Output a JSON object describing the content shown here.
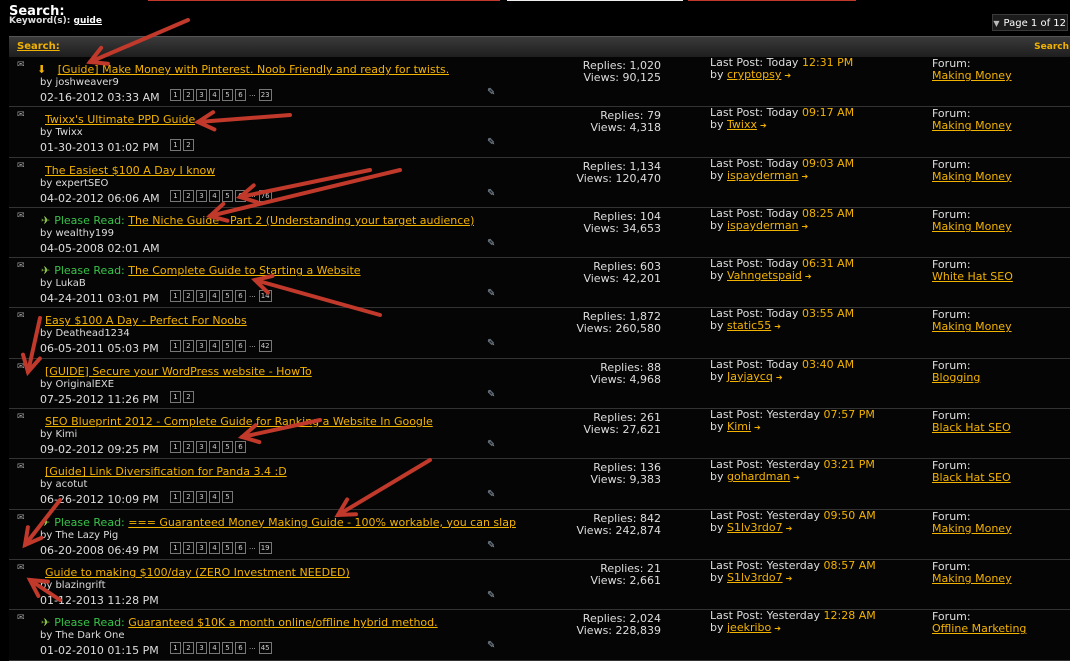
{
  "header": {
    "title": "Search:",
    "keywords_label": "Keyword(s):",
    "keyword": "guide",
    "page_indicator": "Page 1 of 12"
  },
  "table": {
    "title": "Search:",
    "right_label": "Search"
  },
  "colors": {
    "accent": "#f2b200",
    "prefix": "#39c34a",
    "arrow": "#c0392b"
  },
  "threads": [
    {
      "prefix": "",
      "down": "⬇",
      "title": "[Guide] Make Money with Pinterest. Noob Friendly and ready for twists.",
      "author": "joshweaver9",
      "date": "02-16-2012 03:33 AM",
      "pages": [
        "1",
        "2",
        "3",
        "4",
        "5",
        "6",
        "...",
        "23"
      ],
      "replies": "Replies: 1,020",
      "views": "Views: 90,125",
      "last_label": "Last Post: Today",
      "last_time": "12:31 PM",
      "last_user": "cryptopsy",
      "forum_label": "Forum:",
      "forum": "Making Money"
    },
    {
      "prefix": "",
      "down": "",
      "title": "Twixx's Ultimate PPD Guide",
      "author": "Twixx",
      "date": "01-30-2013 01:02 PM",
      "pages": [
        "1",
        "2"
      ],
      "replies": "Replies: 79",
      "views": "Views: 4,318",
      "last_label": "Last Post: Today",
      "last_time": "09:17 AM",
      "last_user": "Twixx",
      "forum_label": "Forum:",
      "forum": "Making Money"
    },
    {
      "prefix": "",
      "down": "",
      "title": "The Easiest $100 A Day I know",
      "author": "expertSEO",
      "date": "04-02-2012 06:06 AM",
      "pages": [
        "1",
        "2",
        "3",
        "4",
        "5",
        "6",
        "...",
        "76"
      ],
      "replies": "Replies: 1,134",
      "views": "Views: 120,470",
      "last_label": "Last Post: Today",
      "last_time": "09:03 AM",
      "last_user": "ispayderman",
      "forum_label": "Forum:",
      "forum": "Making Money"
    },
    {
      "prefix": "Please Read:",
      "down": "",
      "title": "The Niche Guide - Part 2 (Understanding your target audience)",
      "author": "wealthy199",
      "date": "04-05-2008 02:01 AM",
      "pages": [],
      "replies": "Replies: 104",
      "views": "Views: 34,653",
      "last_label": "Last Post: Today",
      "last_time": "08:25 AM",
      "last_user": "ispayderman",
      "forum_label": "Forum:",
      "forum": "Making Money"
    },
    {
      "prefix": "Please Read:",
      "down": "",
      "title": "The Complete Guide to Starting a Website",
      "author": "LukaB",
      "date": "04-24-2011 03:01 PM",
      "pages": [
        "1",
        "2",
        "3",
        "4",
        "5",
        "6",
        "...",
        "14"
      ],
      "replies": "Replies: 603",
      "views": "Views: 42,201",
      "last_label": "Last Post: Today",
      "last_time": "06:31 AM",
      "last_user": "Vahngetspaid",
      "forum_label": "Forum:",
      "forum": "White Hat SEO"
    },
    {
      "prefix": "",
      "down": "",
      "title": "Easy $100 A Day - Perfect For Noobs",
      "author": "Deathead1234",
      "date": "06-05-2011 05:03 PM",
      "pages": [
        "1",
        "2",
        "3",
        "4",
        "5",
        "6",
        "...",
        "42"
      ],
      "replies": "Replies: 1,872",
      "views": "Views: 260,580",
      "last_label": "Last Post: Today",
      "last_time": "03:55 AM",
      "last_user": "static55",
      "forum_label": "Forum:",
      "forum": "Making Money"
    },
    {
      "prefix": "",
      "down": "",
      "title": "[GUIDE] Secure your WordPress website - HowTo",
      "author": "OriginalEXE",
      "date": "07-25-2012 11:26 PM",
      "pages": [
        "1",
        "2"
      ],
      "replies": "Replies: 88",
      "views": "Views: 4,968",
      "last_label": "Last Post: Today",
      "last_time": "03:40 AM",
      "last_user": "Jayjaycq",
      "forum_label": "Forum:",
      "forum": "Blogging"
    },
    {
      "prefix": "",
      "down": "",
      "title": "SEO Blueprint 2012 - Complete Guide for Ranking a Website In Google",
      "author": "Kimi",
      "date": "09-02-2012 09:25 PM",
      "pages": [
        "1",
        "2",
        "3",
        "4",
        "5",
        "6"
      ],
      "replies": "Replies: 261",
      "views": "Views: 27,621",
      "last_label": "Last Post: Yesterday",
      "last_time": "07:57 PM",
      "last_user": "Kimi",
      "forum_label": "Forum:",
      "forum": "Black Hat SEO"
    },
    {
      "prefix": "",
      "down": "",
      "title": "[Guide] Link Diversification for Panda 3.4 :D",
      "author": "acotut",
      "date": "06-26-2012 10:09 PM",
      "pages": [
        "1",
        "2",
        "3",
        "4",
        "5"
      ],
      "replies": "Replies: 136",
      "views": "Views: 9,383",
      "last_label": "Last Post: Yesterday",
      "last_time": "03:21 PM",
      "last_user": "gohardman",
      "forum_label": "Forum:",
      "forum": "Black Hat SEO"
    },
    {
      "prefix": "Please Read:",
      "down": "",
      "title": "=== Guaranteed Money Making Guide - 100% workable, you can slap",
      "author": "The Lazy Pig",
      "date": "06-20-2008 06:49 PM",
      "pages": [
        "1",
        "2",
        "3",
        "4",
        "5",
        "6",
        "...",
        "19"
      ],
      "replies": "Replies: 842",
      "views": "Views: 242,874",
      "last_label": "Last Post: Yesterday",
      "last_time": "09:50 AM",
      "last_user": "S1lv3rdo7",
      "forum_label": "Forum:",
      "forum": "Making Money"
    },
    {
      "prefix": "",
      "down": "",
      "title": "Guide to making $100/day (ZERO Investment NEEDED)",
      "author": "blazingrift",
      "date": "01-12-2013 11:28 PM",
      "pages": [],
      "replies": "Replies: 21",
      "views": "Views: 2,661",
      "last_label": "Last Post: Yesterday",
      "last_time": "08:57 AM",
      "last_user": "S1lv3rdo7",
      "forum_label": "Forum:",
      "forum": "Making Money"
    },
    {
      "prefix": "Please Read:",
      "down": "",
      "title": "Guaranteed $10K a month online/offline hybrid method.",
      "author": "The Dark One",
      "date": "01-02-2010 01:15 PM",
      "pages": [
        "1",
        "2",
        "3",
        "4",
        "5",
        "6",
        "...",
        "45"
      ],
      "replies": "Replies: 2,024",
      "views": "Views: 228,839",
      "last_label": "Last Post: Yesterday",
      "last_time": "12:28 AM",
      "last_user": "jeekribo",
      "forum_label": "Forum:",
      "forum": "Offline Marketing"
    }
  ]
}
